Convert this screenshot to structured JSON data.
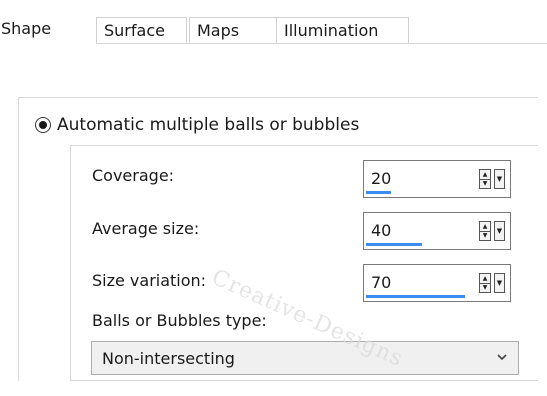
{
  "tabs": [
    {
      "label": "Shape",
      "active": true
    },
    {
      "label": "Surface",
      "active": false
    },
    {
      "label": "Maps",
      "active": false
    },
    {
      "label": "Illumination",
      "active": false
    }
  ],
  "shape": {
    "mode_label": "Automatic multiple balls or bubbles",
    "mode_selected": true,
    "coverage": {
      "label": "Coverage:",
      "value": "20",
      "fill_fraction": 0.18
    },
    "average_size": {
      "label": "Average size:",
      "value": "40",
      "fill_fraction": 0.4
    },
    "size_variation": {
      "label": "Size variation:",
      "value": "70",
      "fill_fraction": 0.71
    },
    "type_label": "Balls or Bubbles type:",
    "type_value": "Non-intersecting"
  },
  "colors": {
    "accent": "#3b8df0"
  },
  "icons": {
    "spinner": "up-down-arrows-icon",
    "dropdown": "chevron-down-icon"
  },
  "watermark": "Creative-Designs"
}
